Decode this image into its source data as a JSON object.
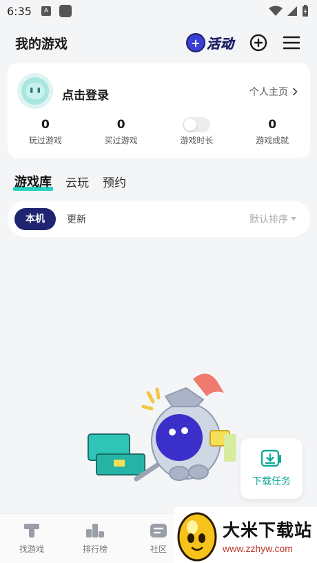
{
  "status_bar": {
    "time": "6:35",
    "app_icon_letter": "A"
  },
  "header": {
    "title": "我的游戏",
    "activity_label": "活动",
    "activity_plus": "+"
  },
  "profile": {
    "login_text": "点击登录",
    "homepage_link": "个人主页",
    "stats": [
      {
        "value": "0",
        "label": "玩过游戏"
      },
      {
        "value": "0",
        "label": "买过游戏"
      },
      {
        "label": "游戏时长"
      },
      {
        "value": "0",
        "label": "游戏成就"
      }
    ]
  },
  "tabs": [
    {
      "label": "游戏库"
    },
    {
      "label": "云玩"
    },
    {
      "label": "预约"
    }
  ],
  "filter": {
    "local_label": "本机",
    "update_label": "更新",
    "sort_label": "默认排序"
  },
  "download_task": {
    "label": "下载任务"
  },
  "bottom_nav": [
    {
      "label": "找游戏",
      "icon": "hammer-icon"
    },
    {
      "label": "排行榜",
      "icon": "leaderboard-icon"
    },
    {
      "label": "社区",
      "icon": "community-icon"
    }
  ],
  "watermark": {
    "title": "大米下载站",
    "url": "www.zzhyw.com"
  },
  "colors": {
    "accent": "#2ad1c2",
    "chip_active": "#1e2470",
    "download": "#13a89a",
    "activity": "#3a3fd8"
  }
}
